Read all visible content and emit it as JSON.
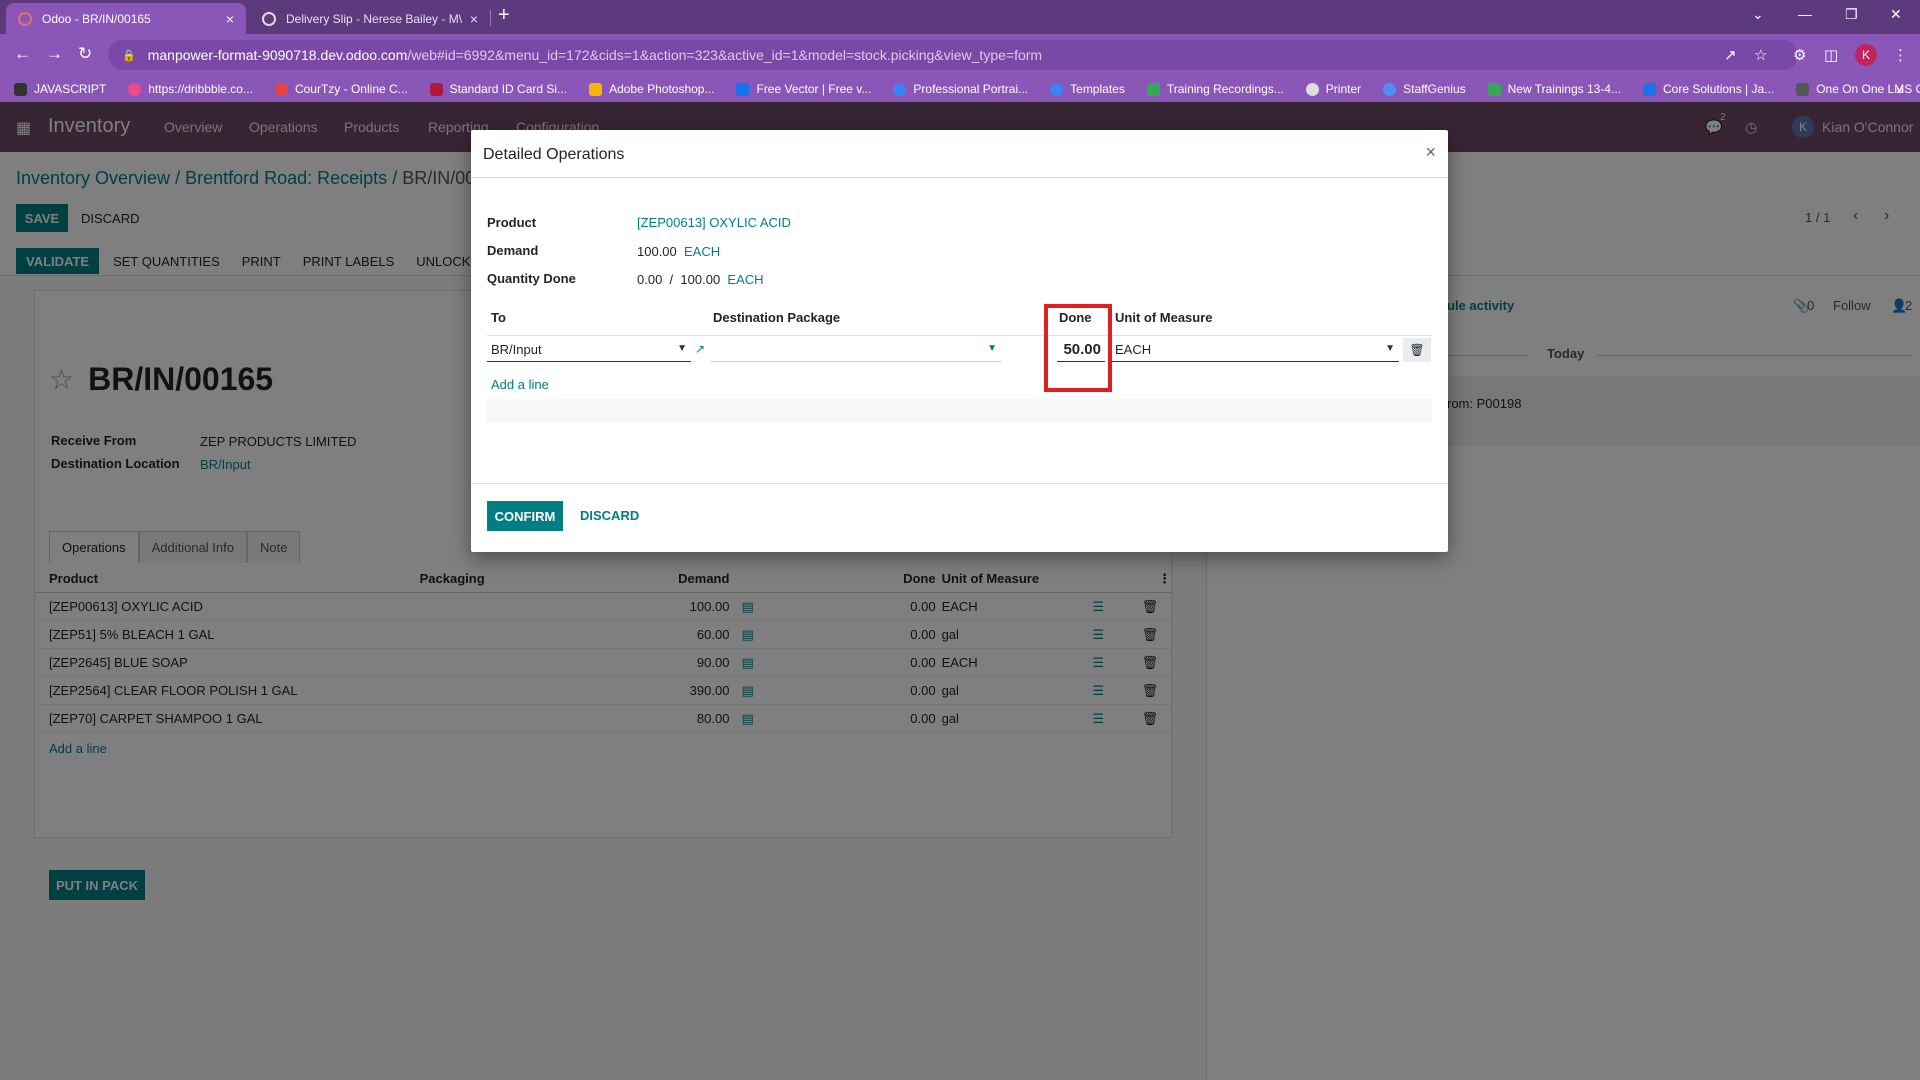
{
  "browser": {
    "tabs": [
      {
        "title": "Odoo - BR/IN/00165",
        "close": "×"
      },
      {
        "title": "Delivery Slip - Nerese Bailey - M\\",
        "close": "×"
      }
    ],
    "new_tab": "+",
    "window_controls": [
      "⌄",
      "—",
      "❐",
      "✕"
    ],
    "url_host": "manpower-format-9090718.dev.odoo.com",
    "url_path": "/web#id=6992&menu_id=172&cids=1&action=323&active_id=1&model=stock.picking&view_type=form",
    "profile_initial": "K",
    "bookmarks": [
      {
        "label": "JAVASCRIPT",
        "color": "#333333"
      },
      {
        "label": "https://dribbble.co...",
        "color": "#ea4c89"
      },
      {
        "label": "CourTzy - Online C...",
        "color": "#e8453c"
      },
      {
        "label": "Standard ID Card Si...",
        "color": "#b0193a"
      },
      {
        "label": "Adobe Photoshop...",
        "color": "#f4b400"
      },
      {
        "label": "Free Vector | Free v...",
        "color": "#1273eb"
      },
      {
        "label": "Professional Portrai...",
        "color": "#3b82f6"
      },
      {
        "label": "Templates",
        "color": "#3b82f6"
      },
      {
        "label": "Training Recordings...",
        "color": "#34a853"
      },
      {
        "label": "Printer",
        "color": "#dddddd"
      },
      {
        "label": "StaffGenius",
        "color": "#4f8ef7"
      },
      {
        "label": "New Trainings 13-4...",
        "color": "#34a853"
      },
      {
        "label": "Core Solutions | Ja...",
        "color": "#1a73e8"
      },
      {
        "label": "One On One LMS O...",
        "color": "#555555"
      }
    ],
    "bookmarks_more": "»"
  },
  "odoo": {
    "app_name": "Inventory",
    "menu": [
      "Overview",
      "Operations",
      "Products",
      "Reporting",
      "Configuration"
    ],
    "user_name": "Kian O'Connor",
    "user_initial": "K",
    "chat_count": "2",
    "breadcrumb": [
      "Inventory Overview",
      "Brentford Road: Receipts",
      "BR/IN/00165"
    ],
    "save_label": "SAVE",
    "discard_label": "DISCARD",
    "pager": "1 / 1",
    "status_buttons": [
      "VALIDATE",
      "SET QUANTITIES",
      "PRINT",
      "PRINT LABELS",
      "UNLOCK"
    ],
    "record_name": "BR/IN/00165",
    "receive_from_label": "Receive From",
    "receive_from_value": "ZEP PRODUCTS LIMITED",
    "dest_location_label": "Destination Location",
    "dest_location_value": "BR/Input",
    "notebook_tabs": [
      "Operations",
      "Additional Info",
      "Note"
    ],
    "ops_headers": {
      "product": "Product",
      "packaging": "Packaging",
      "demand": "Demand",
      "done": "Done",
      "uom": "Unit of Measure"
    },
    "ops_rows": [
      {
        "product": "[ZEP00613] OXYLIC ACID",
        "demand": "100.00",
        "done": "0.00",
        "uom": "EACH"
      },
      {
        "product": "[ZEP51] 5% BLEACH 1 GAL",
        "demand": "60.00",
        "done": "0.00",
        "uom": "gal"
      },
      {
        "product": "[ZEP2645] BLUE SOAP",
        "demand": "90.00",
        "done": "0.00",
        "uom": "EACH"
      },
      {
        "product": "[ZEP2564] CLEAR FLOOR POLISH 1 GAL",
        "demand": "390.00",
        "done": "0.00",
        "uom": "gal"
      },
      {
        "product": "[ZEP70] CARPET SHAMPOO 1 GAL",
        "demand": "80.00",
        "done": "0.00",
        "uom": "gal"
      }
    ],
    "add_line": "Add a line",
    "put_in_pack": "PUT IN PACK",
    "chatter": {
      "schedule_activity": "ule activity",
      "attachments": "0",
      "follow": "Follow",
      "followers": "2",
      "today": "Today",
      "message_snippet": "rom: P00198"
    }
  },
  "modal": {
    "title": "Detailed Operations",
    "close": "×",
    "product_label": "Product",
    "product_value": "[ZEP00613] OXYLIC ACID",
    "demand_label": "Demand",
    "demand_qty": "100.00",
    "demand_uom": "EACH",
    "qty_done_label": "Quantity Done",
    "qty_done_value": "0.00",
    "qty_done_sep": "/",
    "qty_done_total": "100.00",
    "qty_done_uom": "EACH",
    "col_to": "To",
    "col_dest_package": "Destination Package",
    "col_done": "Done",
    "col_uom": "Unit of Measure",
    "row_to": "BR/Input",
    "row_package": "",
    "row_done": "50.00",
    "row_uom": "EACH",
    "add_line": "Add a line",
    "confirm_label": "CONFIRM",
    "discard_label": "DISCARD"
  },
  "colors": {
    "odoo_primary": "#714b67",
    "odoo_teal": "#017e84",
    "highlight": "#e02020",
    "browser_purple": "#8a56b8"
  }
}
